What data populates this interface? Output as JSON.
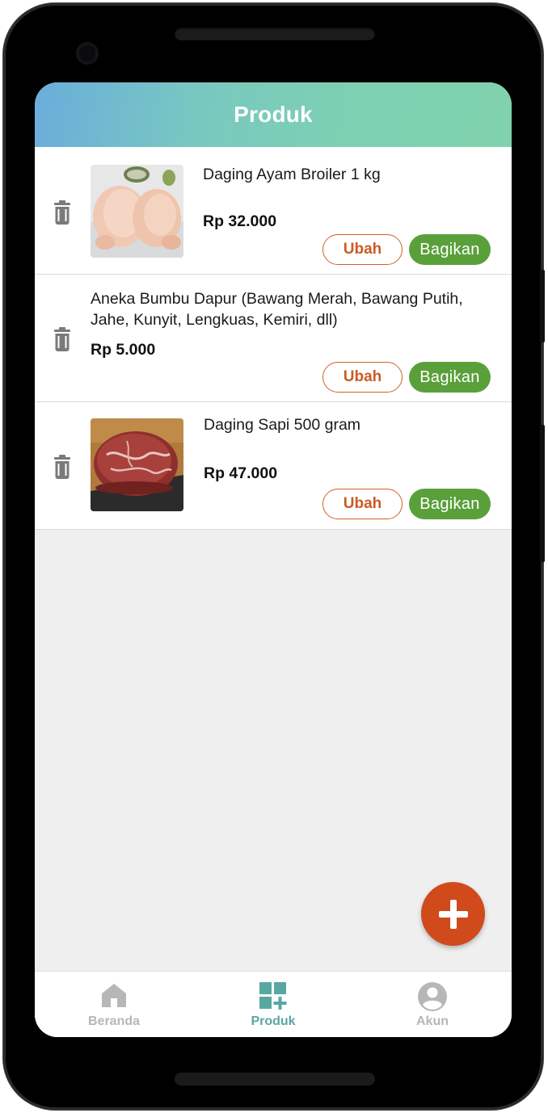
{
  "appbar": {
    "title": "Produk"
  },
  "products": [
    {
      "title": "Daging Ayam Broiler 1 kg",
      "price": "Rp 32.000",
      "edit_label": "Ubah",
      "share_label": "Bagikan",
      "image": "chicken-photo"
    },
    {
      "title": "Aneka Bumbu Dapur (Bawang Merah, Bawang Putih, Jahe, Kunyit, Lengkuas, Kemiri, dll)",
      "price": "Rp 5.000",
      "edit_label": "Ubah",
      "share_label": "Bagikan",
      "image": null
    },
    {
      "title": "Daging Sapi 500 gram",
      "price": "Rp 47.000",
      "edit_label": "Ubah",
      "share_label": "Bagikan",
      "image": "beef-photo"
    }
  ],
  "fab": {
    "icon": "plus-icon"
  },
  "nav": {
    "items": [
      {
        "label": "Beranda",
        "icon": "home-icon",
        "active": false
      },
      {
        "label": "Produk",
        "icon": "product-grid-add-icon",
        "active": true
      },
      {
        "label": "Akun",
        "icon": "account-circle-icon",
        "active": false
      }
    ]
  },
  "colors": {
    "accent_green": "#5aa03a",
    "accent_orange": "#d04a1c",
    "nav_active": "#5aa7a1",
    "nav_inactive": "#b7b7b7"
  }
}
